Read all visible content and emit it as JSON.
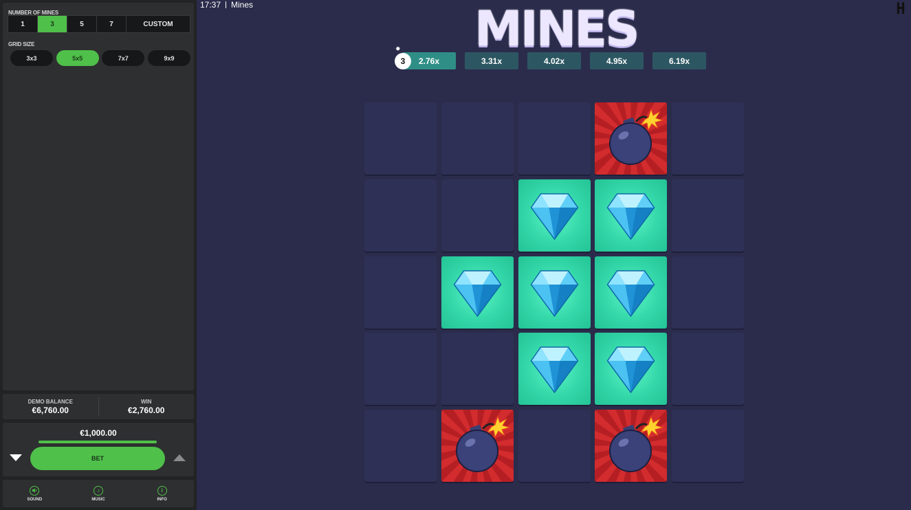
{
  "header": {
    "clock": "17:37",
    "app_title": "Mines",
    "logo_text": "MINES",
    "corner_logo": "H"
  },
  "sidebar": {
    "mines_label": "NUMBER OF MINES",
    "mines_options": [
      "1",
      "3",
      "5",
      "7",
      "CUSTOM"
    ],
    "mines_selected": "3",
    "grid_label": "GRID SIZE",
    "grid_options": [
      "3x3",
      "5x5",
      "7x7",
      "9x9"
    ],
    "grid_selected": "5x5",
    "balance_label": "DEMO BALANCE",
    "balance_value": "€6,760.00",
    "win_label": "WIN",
    "win_value": "€2,760.00",
    "bet_amount": "€1,000.00",
    "bet_label": "BET",
    "footer": [
      {
        "label": "SOUND",
        "icon": "speaker-icon"
      },
      {
        "label": "MUSIC",
        "icon": "music-note-icon"
      },
      {
        "label": "INFO",
        "icon": "info-icon"
      }
    ]
  },
  "multipliers": {
    "mine_count": "3",
    "values": [
      "2.76x",
      "3.31x",
      "4.02x",
      "4.95x",
      "6.19x"
    ],
    "active_index": 0
  },
  "board": {
    "size": 5,
    "cells": [
      [
        "hidden",
        "hidden",
        "hidden",
        "mine",
        "hidden"
      ],
      [
        "hidden",
        "hidden",
        "gem",
        "gem",
        "hidden"
      ],
      [
        "hidden",
        "gem",
        "gem",
        "gem",
        "hidden"
      ],
      [
        "hidden",
        "hidden",
        "gem",
        "gem",
        "hidden"
      ],
      [
        "hidden",
        "mine",
        "hidden",
        "mine",
        "hidden"
      ]
    ]
  },
  "colors": {
    "accent": "#4fc04a",
    "background": "#2b2c4b",
    "tile_hidden": "#2e3055",
    "tile_gem": "#33d7a8",
    "tile_mine": "#d32c2e",
    "multiplier": "#2c5762"
  }
}
